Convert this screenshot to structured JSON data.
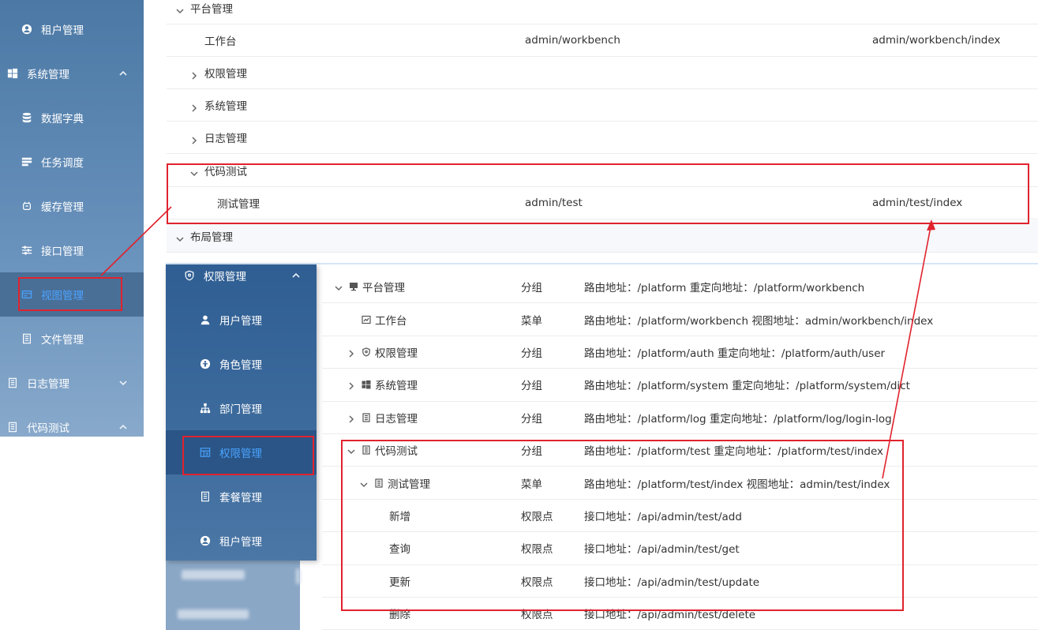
{
  "sidebar_top": {
    "items": [
      {
        "label": "租户管理",
        "icon": "user-circle-icon"
      },
      {
        "label": "系统管理",
        "icon": "windows-icon"
      },
      {
        "label": "数据字典",
        "icon": "database-icon"
      },
      {
        "label": "任务调度",
        "icon": "schedule-icon"
      },
      {
        "label": "缓存管理",
        "icon": "cache-icon"
      },
      {
        "label": "接口管理",
        "icon": "sliders-icon"
      },
      {
        "label": "视图管理",
        "icon": "view-icon"
      },
      {
        "label": "文件管理",
        "icon": "file-icon"
      },
      {
        "label": "日志管理",
        "icon": "log-icon"
      },
      {
        "label": "代码测试",
        "icon": "code-test-icon"
      }
    ]
  },
  "table_top": {
    "rows": [
      {
        "name": "平台管理",
        "view": "",
        "component": ""
      },
      {
        "name": "工作台",
        "view": "admin/workbench",
        "component": "admin/workbench/index"
      },
      {
        "name": "权限管理",
        "view": "",
        "component": ""
      },
      {
        "name": "系统管理",
        "view": "",
        "component": ""
      },
      {
        "name": "日志管理",
        "view": "",
        "component": ""
      },
      {
        "name": "代码测试",
        "view": "",
        "component": ""
      },
      {
        "name": "测试管理",
        "view": "admin/test",
        "component": "admin/test/index"
      },
      {
        "name": "布局管理",
        "view": "",
        "component": ""
      }
    ]
  },
  "sidebar_bottom": {
    "items": [
      {
        "label": "权限管理",
        "icon": "shield-icon"
      },
      {
        "label": "用户管理",
        "icon": "user-icon"
      },
      {
        "label": "角色管理",
        "icon": "role-icon"
      },
      {
        "label": "部门管理",
        "icon": "org-chart-icon"
      },
      {
        "label": "权限管理",
        "icon": "permission-icon"
      },
      {
        "label": "套餐管理",
        "icon": "package-icon"
      },
      {
        "label": "租户管理",
        "icon": "user-circle-icon"
      }
    ]
  },
  "table_bottom": {
    "rows": [
      {
        "name": "平台管理",
        "type": "分组",
        "path": "路由地址：/platform 重定向地址：/platform/workbench"
      },
      {
        "name": "工作台",
        "type": "菜单",
        "path": "路由地址：/platform/workbench 视图地址：admin/workbench/index"
      },
      {
        "name": "权限管理",
        "type": "分组",
        "path": "路由地址：/platform/auth 重定向地址：/platform/auth/user"
      },
      {
        "name": "系统管理",
        "type": "分组",
        "path": "路由地址：/platform/system 重定向地址：/platform/system/dict"
      },
      {
        "name": "日志管理",
        "type": "分组",
        "path": "路由地址：/platform/log 重定向地址：/platform/log/login-log"
      },
      {
        "name": "代码测试",
        "type": "分组",
        "path": "路由地址：/platform/test 重定向地址：/platform/test/index"
      },
      {
        "name": "测试管理",
        "type": "菜单",
        "path": "路由地址：/platform/test/index 视图地址：admin/test/index"
      },
      {
        "name": "新增",
        "type": "权限点",
        "path": "接口地址：/api/admin/test/add"
      },
      {
        "name": "查询",
        "type": "权限点",
        "path": "接口地址：/api/admin/test/get"
      },
      {
        "name": "更新",
        "type": "权限点",
        "path": "接口地址：/api/admin/test/update"
      },
      {
        "name": "删除",
        "type": "权限点",
        "path": "接口地址：/api/admin/test/delete"
      }
    ]
  },
  "colors": {
    "highlight": "#e0232d",
    "active_text": "#4aa3ff",
    "sidebar_top": "#5b86b2",
    "sidebar_bottom": "#35639a"
  }
}
